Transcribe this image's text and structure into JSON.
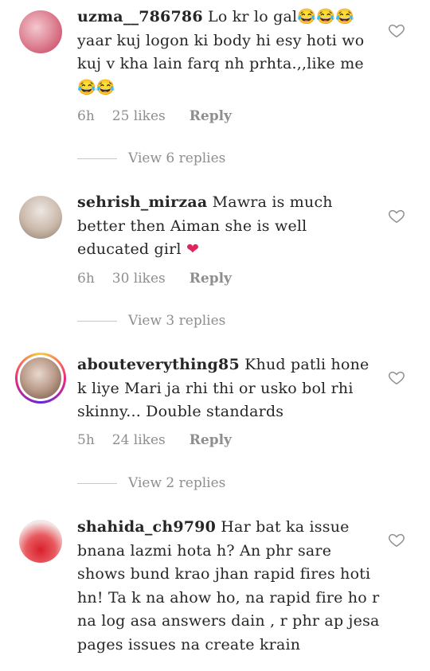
{
  "comments": [
    {
      "username": "uzma__786786",
      "text": "Lo kr lo gal😂😂😂 yaar kuj logon ki body hi esy hoti wo kuj v kha lain farq nh prhta.,,like me 😂😂",
      "time": "6h",
      "likes": "25 likes",
      "reply": "Reply",
      "view_replies": "View 6 replies",
      "avatar_colors": [
        "#f3c7cf",
        "#c63a56"
      ]
    },
    {
      "username": "sehrish_mirzaa",
      "text": "Mawra is much better then Aiman she is well educated girl ❤",
      "time": "6h",
      "likes": "30 likes",
      "reply": "Reply",
      "view_replies": "View 3 replies",
      "avatar_colors": [
        "#ece7e3",
        "#b59d8c"
      ]
    },
    {
      "username": "abouteverything85",
      "text": "Khud  patli hone k liye Mari ja rhi thi or usko bol rhi skinny... Double standards",
      "time": "5h",
      "likes": "24 likes",
      "reply": "Reply",
      "view_replies": "View 2 replies",
      "avatar_colors": [
        "#d9c6bc",
        "#7a5b4e"
      ]
    },
    {
      "username": "shahida_ch9790",
      "text": "Har bat ka issue bnana lazmi hota h? An phr sare shows bund krao jhan rapid fires hoti hn! Ta k na ahow ho, na rapid fire ho r na log asa answers dain , r phr ap jesa pages issues na create krain",
      "avatar_colors": [
        "#f4e6e6",
        "#d8202c"
      ]
    }
  ],
  "icons": {
    "like": "heart-outline-icon"
  }
}
